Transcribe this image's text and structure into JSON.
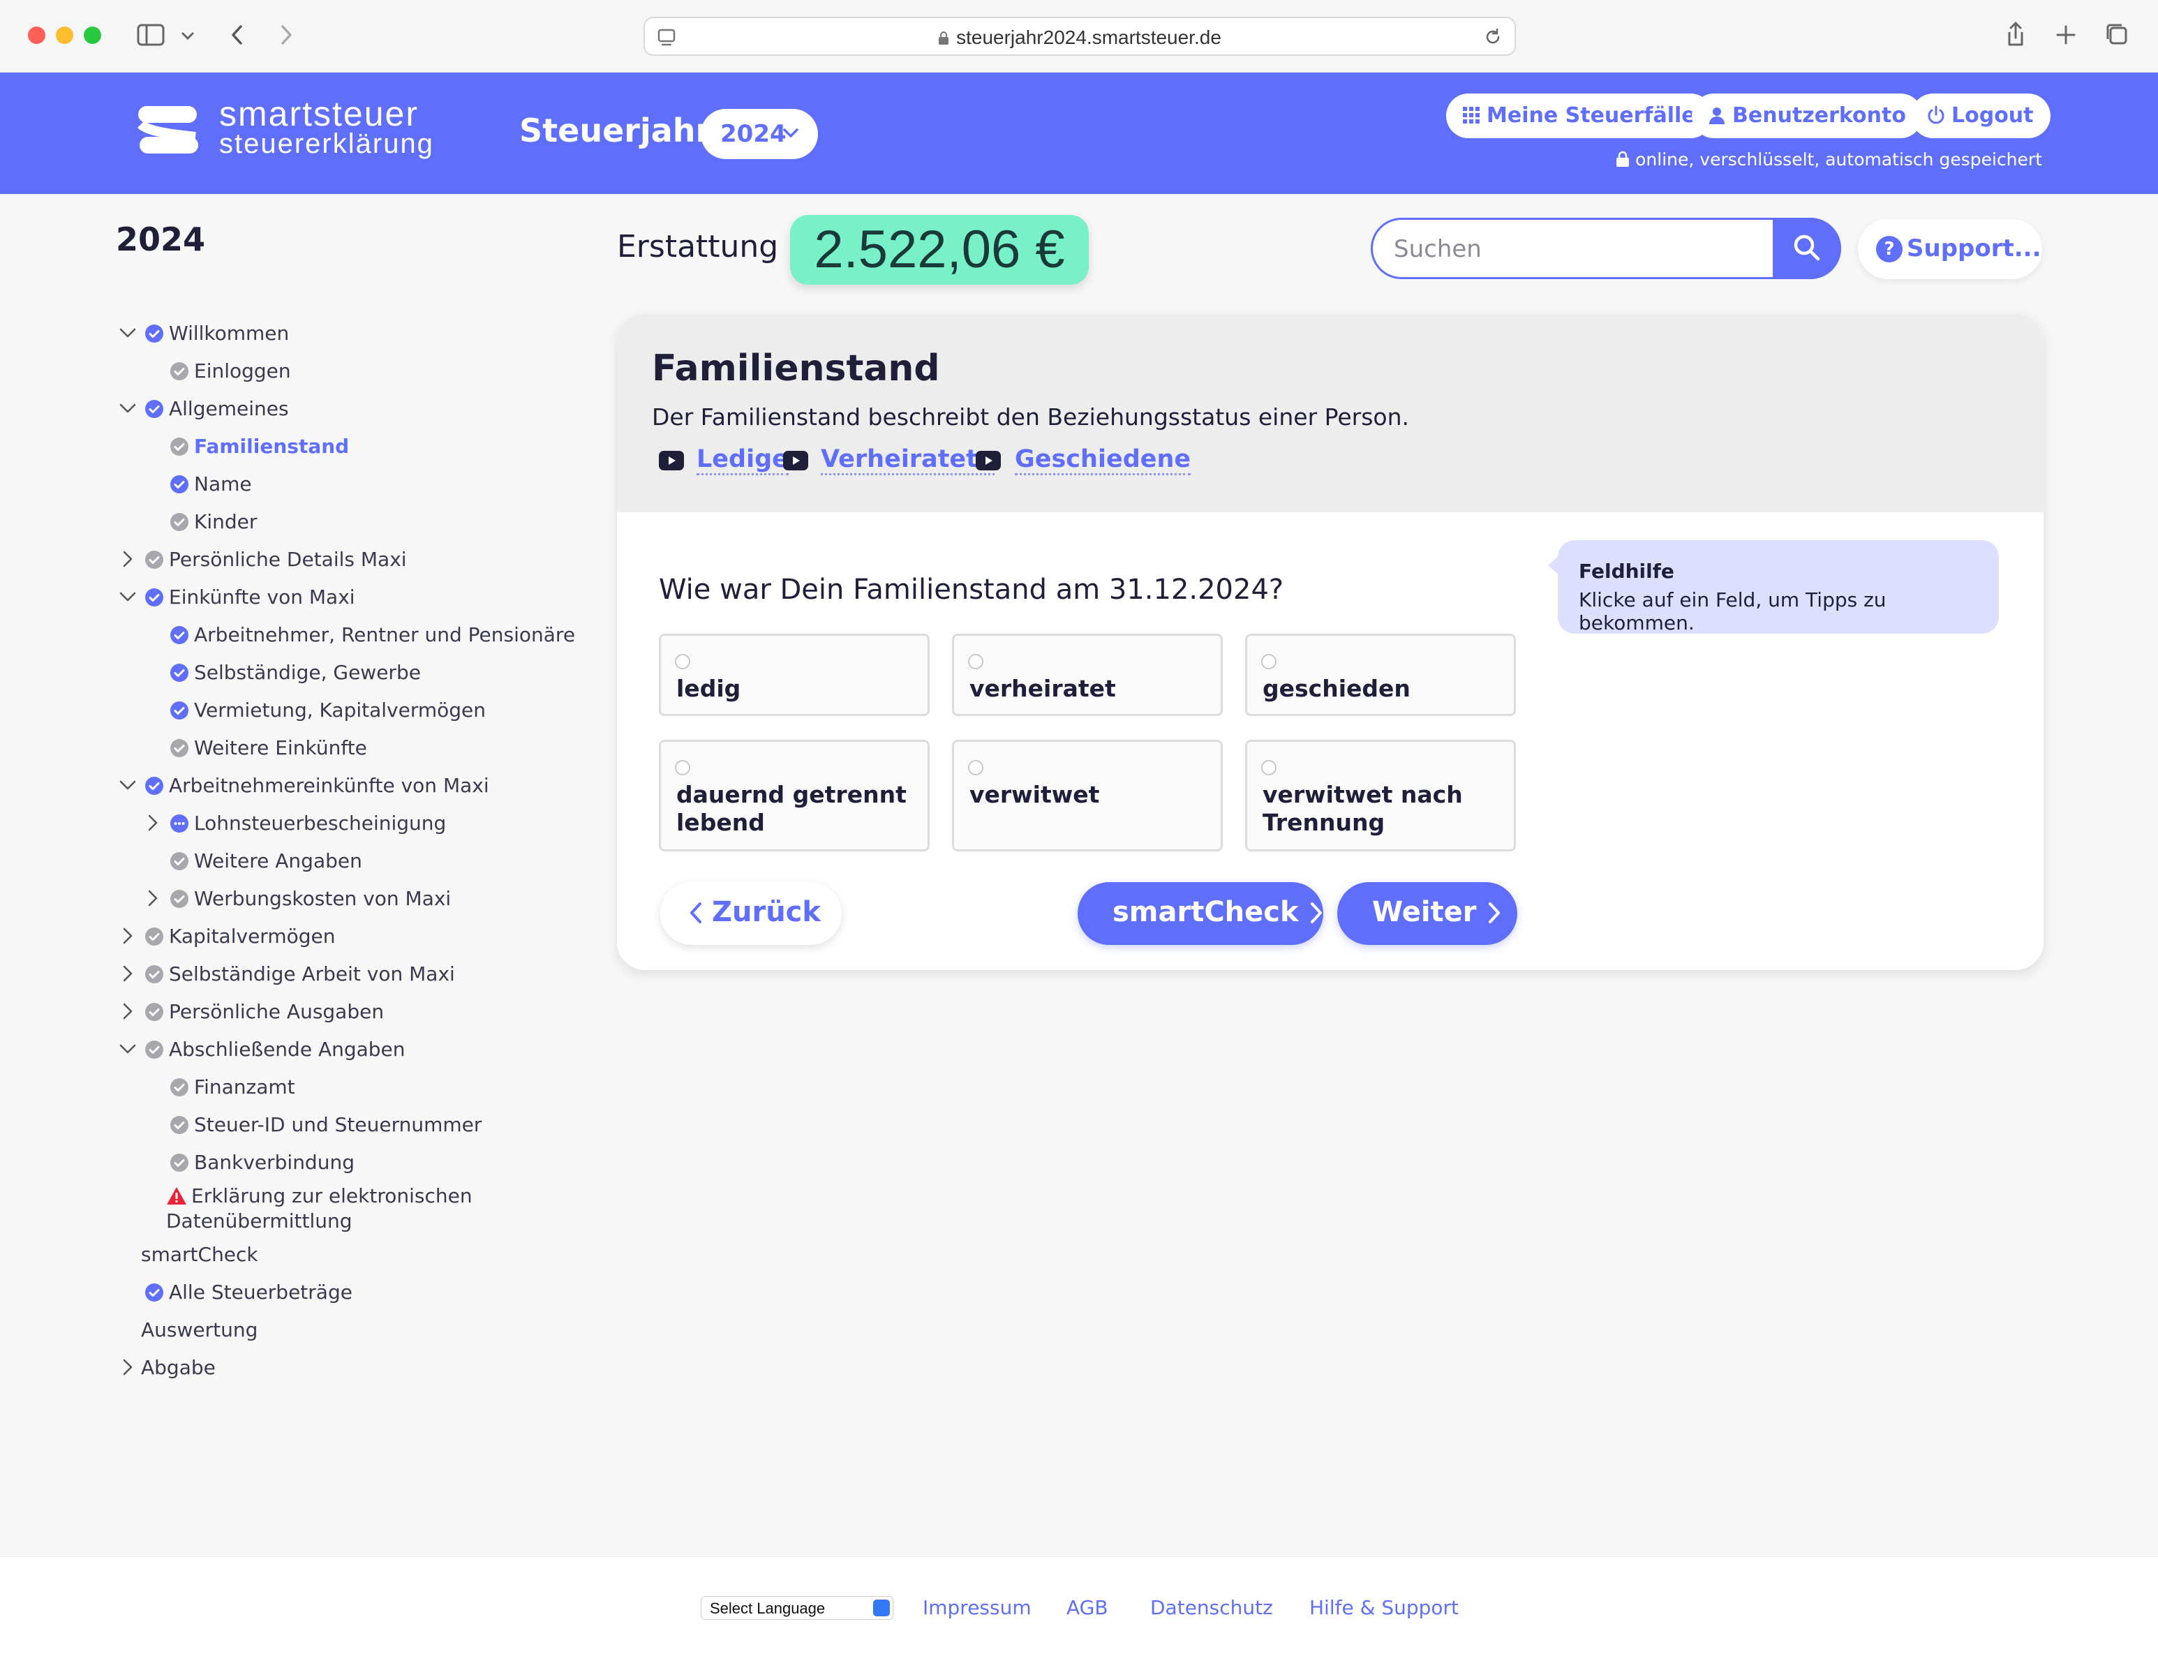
{
  "browser": {
    "url": "steuerjahr2024.smartsteuer.de"
  },
  "header": {
    "logo_line1": "smartsteuer",
    "logo_line2": "steuererklärung",
    "steuerjahr_label": "Steuerjahr",
    "year": "2024",
    "buttons": {
      "steuerfaelle": "Meine Steuerfälle",
      "konto": "Benutzerkonto",
      "logout": "Logout"
    },
    "saved_note": "online, verschlüsselt, automatisch gespeichert"
  },
  "sidebar": {
    "year": "2024",
    "items": [
      {
        "label": "Willkommen",
        "status": "done-blue"
      },
      {
        "label": "Einloggen",
        "status": "done-grey"
      },
      {
        "label": "Allgemeines",
        "status": "done-blue"
      },
      {
        "label": "Familienstand",
        "status": "done-grey",
        "active": true
      },
      {
        "label": "Name",
        "status": "done-blue"
      },
      {
        "label": "Kinder",
        "status": "done-grey"
      },
      {
        "label": "Persönliche Details Maxi",
        "status": "done-grey"
      },
      {
        "label": "Einkünfte von Maxi",
        "status": "done-blue"
      },
      {
        "label": "Arbeitnehmer, Rentner und Pensionäre",
        "status": "done-blue"
      },
      {
        "label": "Selbständige, Gewerbe",
        "status": "done-blue"
      },
      {
        "label": "Vermietung, Kapitalvermögen",
        "status": "done-blue"
      },
      {
        "label": "Weitere Einkünfte",
        "status": "done-grey"
      },
      {
        "label": "Arbeitnehmereinkünfte von Maxi",
        "status": "done-blue"
      },
      {
        "label": "Lohnsteuerbescheinigung",
        "status": "in-progress"
      },
      {
        "label": "Weitere Angaben",
        "status": "done-grey"
      },
      {
        "label": "Werbungskosten von Maxi",
        "status": "done-grey"
      },
      {
        "label": "Kapitalvermögen",
        "status": "done-grey"
      },
      {
        "label": "Selbständige Arbeit von Maxi",
        "status": "done-grey"
      },
      {
        "label": "Persönliche Ausgaben",
        "status": "done-grey"
      },
      {
        "label": "Abschließende Angaben",
        "status": "done-grey"
      },
      {
        "label": "Finanzamt",
        "status": "done-grey"
      },
      {
        "label": "Steuer-ID und Steuernummer",
        "status": "done-grey"
      },
      {
        "label": "Bankverbindung",
        "status": "done-grey"
      },
      {
        "label": "Erklärung zur elektronischen Datenübermittlung",
        "status": "warning"
      },
      {
        "label": "smartCheck",
        "status": "none"
      },
      {
        "label": "Alle Steuerbeträge",
        "status": "done-blue"
      },
      {
        "label": "Auswertung",
        "status": "none"
      },
      {
        "label": "Abgabe",
        "status": "none"
      }
    ]
  },
  "refund": {
    "label": "Erstattung",
    "value": "2.522,06 €"
  },
  "search": {
    "placeholder": "Suchen"
  },
  "support": {
    "label": "Support..."
  },
  "card": {
    "title": "Familienstand",
    "description": "Der Familienstand beschreibt den Beziehungsstatus einer Person.",
    "video_links": [
      "Ledige",
      "Verheiratete",
      "Geschiedene"
    ],
    "question": "Wie war Dein Familienstand am 31.12.2024?",
    "options": [
      "ledig",
      "verheiratet",
      "geschieden",
      "dauernd getrennt lebend",
      "verwitwet",
      "verwitwet nach Trennung"
    ],
    "fieldhelp_title": "Feldhilfe",
    "fieldhelp_text": "Klicke auf ein Feld, um Tipps zu bekommen.",
    "back_label": "Zurück",
    "smartcheck_label": "smartCheck",
    "next_label": "Weiter"
  },
  "footer": {
    "language_select": "Select Language",
    "links": [
      "Impressum",
      "AGB",
      "Datenschutz",
      "Hilfe & Support"
    ]
  },
  "colors": {
    "brand": "#5f6ffb",
    "refund_bg": "#78f0c8",
    "warning": "#e8233a"
  }
}
